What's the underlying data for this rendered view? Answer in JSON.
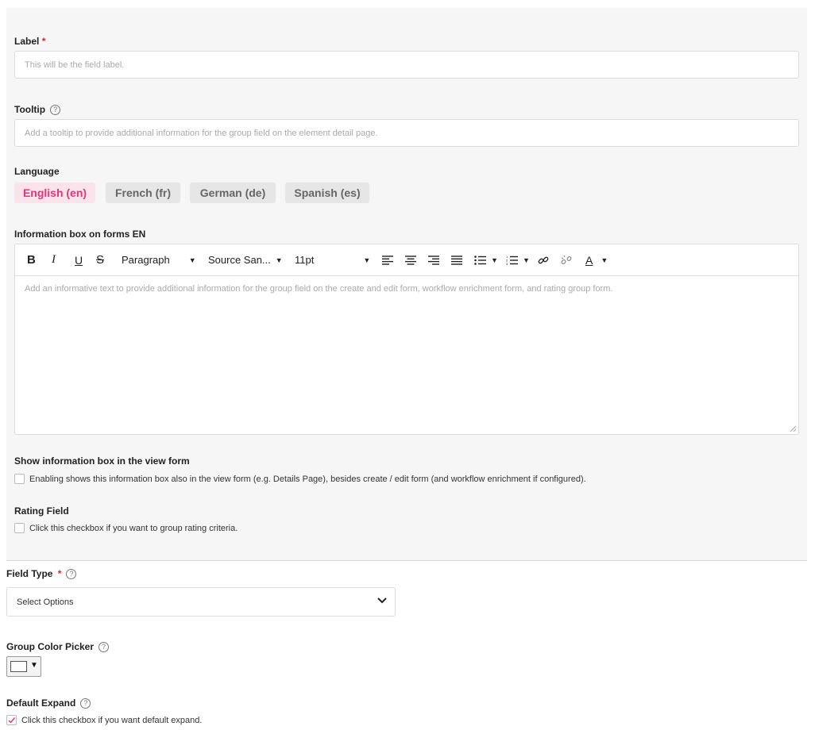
{
  "label_field": {
    "label": "Label",
    "required_mark": "*",
    "placeholder": "This will be the field label."
  },
  "tooltip_field": {
    "label": "Tooltip",
    "help": "?",
    "placeholder": "Add a tooltip to provide additional information for the group field on the element detail page."
  },
  "language": {
    "label": "Language",
    "options": [
      "English (en)",
      "French (fr)",
      "German (de)",
      "Spanish (es)"
    ],
    "selected": "English (en)"
  },
  "info_box": {
    "label": "Information box on forms EN",
    "toolbar": {
      "bold": "B",
      "italic": "I",
      "underline": "U",
      "strikethrough": "S",
      "block_format": "Paragraph",
      "font_family": "Source San...",
      "font_size": "11pt",
      "text_color": "A"
    },
    "placeholder": "Add an informative text to provide additional information for the group field on the create and edit form, workflow enrichment form, and rating group form."
  },
  "show_info": {
    "label": "Show information box in the view form",
    "checkbox_text": "Enabling shows this information box also in the view form (e.g. Details Page), besides create / edit form (and workflow enrichment if configured).",
    "checked": false
  },
  "rating_field": {
    "label": "Rating Field",
    "checkbox_text": "Click this checkbox if you want to group rating criteria.",
    "checked": false
  },
  "field_type": {
    "label": "Field Type",
    "required_mark": "*",
    "help": "?",
    "value": "Select Options"
  },
  "group_color": {
    "label": "Group Color Picker",
    "help": "?",
    "color": "#ffffff"
  },
  "default_expand": {
    "label": "Default Expand",
    "help": "?",
    "checkbox_text": "Click this checkbox if you want default expand.",
    "checked": true
  },
  "colors": {
    "accent": "#e6337a",
    "accent_bg": "#fbe3ec",
    "required": "#d9262c"
  }
}
